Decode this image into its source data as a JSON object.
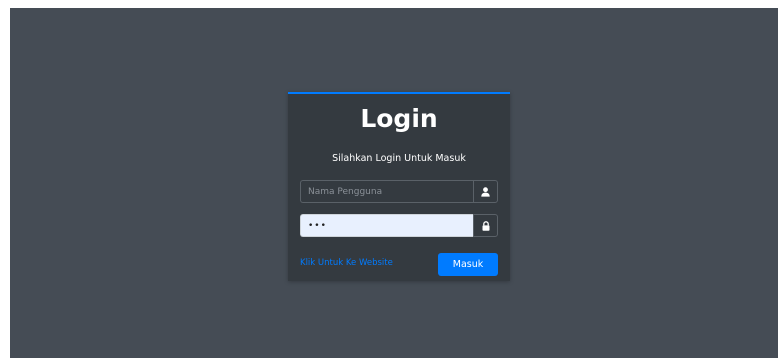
{
  "login": {
    "title": "Login",
    "subtitle": "Silahkan Login Untuk Masuk",
    "username": {
      "placeholder": "Nama Pengguna",
      "value": "",
      "icon": "user-icon"
    },
    "password": {
      "value": "•••",
      "icon": "lock-icon"
    },
    "website_link": "Klik Untuk Ke Website",
    "submit_label": "Masuk"
  },
  "colors": {
    "background": "#454c55",
    "card": "#343a40",
    "accent": "#007bff",
    "autofill": "#e8f0fe"
  }
}
